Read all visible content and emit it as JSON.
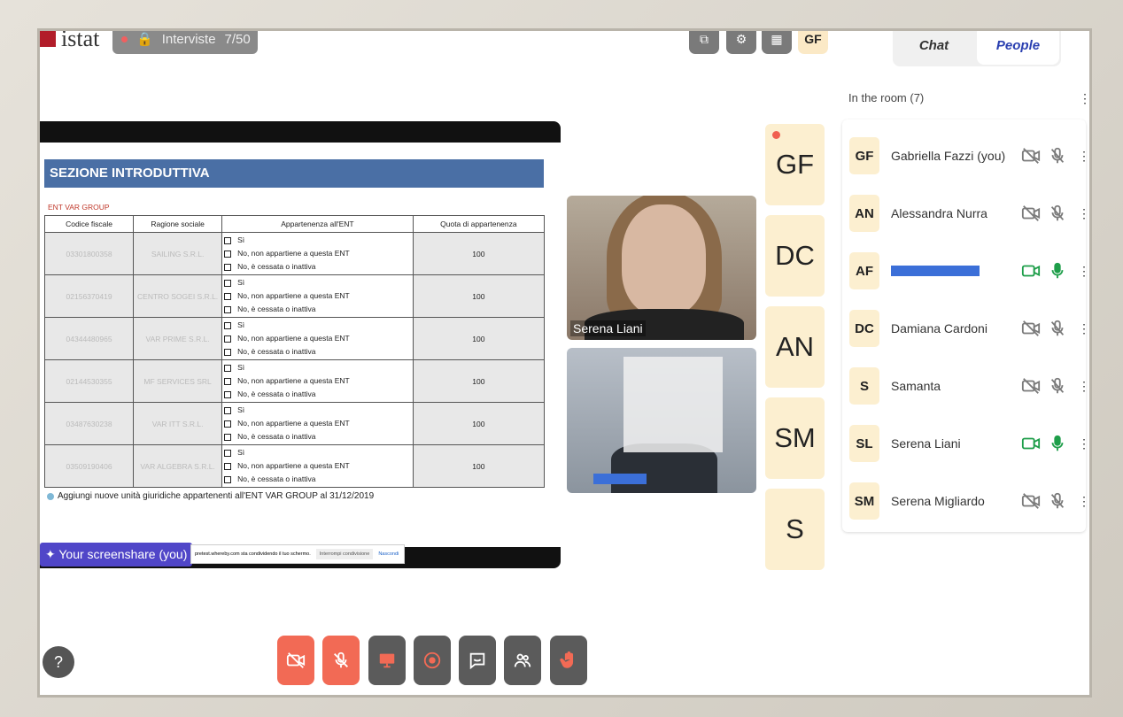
{
  "header": {
    "logo_text": "istat",
    "room_label": "Interviste",
    "room_count": "7/50",
    "my_initials": "GF"
  },
  "doc": {
    "section_title": "SEZIONE INTRODUTTIVA",
    "ent_label": "ENT VAR GROUP",
    "columns": [
      "Codice fiscale",
      "Ragione sociale",
      "Appartenenza all'ENT",
      "Quota di appartenenza"
    ],
    "options": [
      "Sì",
      "No, non appartiene a questa ENT",
      "No, è cessata o inattiva"
    ],
    "rows": [
      {
        "cf": "03301800358",
        "rs": "SAILING S.R.L.",
        "q": "100"
      },
      {
        "cf": "02156370419",
        "rs": "CENTRO SOGEI S.R.L.",
        "q": "100"
      },
      {
        "cf": "04344480965",
        "rs": "VAR PRIME S.R.L.",
        "q": "100"
      },
      {
        "cf": "02144530355",
        "rs": "MF SERVICES SRL",
        "q": "100"
      },
      {
        "cf": "03487630238",
        "rs": "VAR ITT S.R.L.",
        "q": "100"
      },
      {
        "cf": "03509190406",
        "rs": "VAR ALGEBRA S.R.L.",
        "q": "100"
      }
    ],
    "add_text": "Aggiungi nuove unità giuridiche appartenenti all'ENT VAR GROUP al 31/12/2019"
  },
  "share": {
    "tag": "Your screenshare (you)",
    "notice": "pretest.whereby.com sta condividendo il tuo schermo.",
    "stop": "Interrompi condivisione",
    "hide": "Nascondi"
  },
  "videos": [
    {
      "name": "Serena Liani"
    }
  ],
  "tiles": [
    "GF",
    "DC",
    "AN",
    "SM",
    "S"
  ],
  "panel": {
    "tab_chat": "Chat",
    "tab_people": "People",
    "room_text": "In the room (7)",
    "people": [
      {
        "initials": "GF",
        "name": "Gabriella Fazzi (you)",
        "on": false
      },
      {
        "initials": "AN",
        "name": "Alessandra Nurra",
        "on": false
      },
      {
        "initials": "AF",
        "name": "",
        "on": true
      },
      {
        "initials": "DC",
        "name": "Damiana Cardoni",
        "on": false
      },
      {
        "initials": "S",
        "name": "Samanta",
        "on": false
      },
      {
        "initials": "SL",
        "name": "Serena Liani",
        "on": true
      },
      {
        "initials": "SM",
        "name": "Serena Migliardo",
        "on": false
      }
    ]
  },
  "toolbar": {
    "help": "?"
  },
  "colors": {
    "accent": "#5046c8",
    "danger": "#f26a55",
    "on": "#1e9e4a",
    "off": "#7a7a7a"
  }
}
